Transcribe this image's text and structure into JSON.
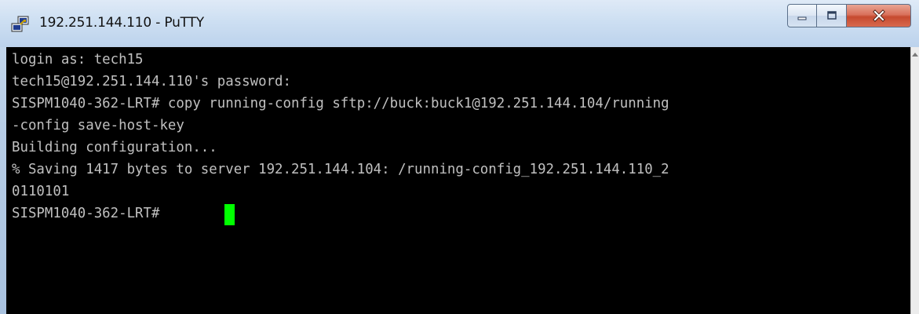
{
  "window": {
    "title": "192.251.144.110 - PuTTY",
    "app_icon": "putty-icon"
  },
  "controls": {
    "minimize_icon": "minimize-icon",
    "maximize_icon": "maximize-icon",
    "close_icon": "close-icon"
  },
  "terminal": {
    "lines": [
      "login as: tech15",
      "tech15@192.251.144.110's password:",
      "SISPM1040-362-LRT# copy running-config sftp://buck:buck1@192.251.144.104/running",
      "-config save-host-key",
      "Building configuration...",
      "% Saving 1417 bytes to server 192.251.144.104: /running-config_192.251.144.110_2",
      "0110101",
      "SISPM1040-362-LRT# "
    ],
    "cursor_color": "#00ff00",
    "text_color": "#c0c0c0",
    "background": "#000000"
  }
}
